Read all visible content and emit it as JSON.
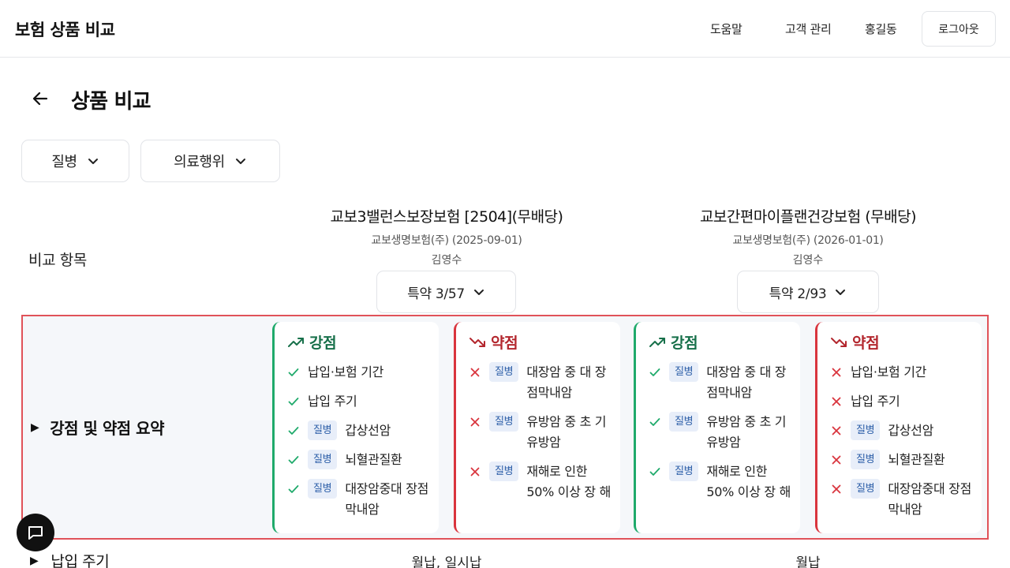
{
  "header": {
    "brand": "보험 상품 비교",
    "nav": [
      "도움말",
      "고객 관리",
      "홍길동"
    ],
    "logout_label": "로그아웃"
  },
  "page": {
    "title": "상품 비교"
  },
  "filters": [
    "질병",
    "의료행위"
  ],
  "compare_label": "비교 항목",
  "products": [
    {
      "name": "교보3밸런스보장보험 [2504](무배당)",
      "company": "교보생명보험(주) (2025-09-01)",
      "agent": "김영수",
      "rider_label": "특약 3/57"
    },
    {
      "name": "교보간편마이플랜건강보험 (무배당)",
      "company": "교보생명보험(주) (2026-01-01)",
      "agent": "김영수",
      "rider_label": "특약 2/93"
    }
  ],
  "summary": {
    "label": "강점 및 약점 요약",
    "strength_title": "강점",
    "weakness_title": "약점",
    "cards": [
      {
        "kind": "pro",
        "items": [
          {
            "tag": "",
            "text": "납입·보험 기간"
          },
          {
            "tag": "",
            "text": "납입 주기"
          },
          {
            "tag": "질병",
            "text": "갑상선암"
          },
          {
            "tag": "질병",
            "text": "뇌혈관질환"
          },
          {
            "tag": "질병",
            "text": "대장암중대 장점막내암"
          }
        ]
      },
      {
        "kind": "con",
        "items": [
          {
            "tag": "질병",
            "text": "대장암 중 대 장점막내암"
          },
          {
            "tag": "질병",
            "text": "유방암 중 초 기유방암"
          },
          {
            "tag": "질병",
            "text": "재해로 인한 50% 이상 장 해"
          }
        ]
      },
      {
        "kind": "pro",
        "items": [
          {
            "tag": "질병",
            "text": "대장암 중 대 장점막내암"
          },
          {
            "tag": "질병",
            "text": "유방암 중 초 기유방암"
          },
          {
            "tag": "질병",
            "text": "재해로 인한 50% 이상 장 해"
          }
        ]
      },
      {
        "kind": "con",
        "items": [
          {
            "tag": "",
            "text": "납입·보험 기간"
          },
          {
            "tag": "",
            "text": "납입 주기"
          },
          {
            "tag": "질병",
            "text": "갑상선암"
          },
          {
            "tag": "질병",
            "text": "뇌혈관질환"
          },
          {
            "tag": "질병",
            "text": "대장암중대 장점막내암"
          }
        ]
      }
    ]
  },
  "payment_row": {
    "label": "납입 주기",
    "values": [
      "월납, 일시납",
      "월납"
    ]
  },
  "icons": {
    "back": "arrow-left-icon",
    "chevron": "chevron-down-icon",
    "strength": "trending-up-icon",
    "weakness": "trending-down-icon",
    "check": "check-icon",
    "cross": "x-icon",
    "chat": "chat-bubble-icon",
    "expand": "triangle-right-icon"
  },
  "colors": {
    "strength": "#1faa6b",
    "weakness": "#d9343d",
    "highlight_border": "#e05259",
    "tag_bg": "#e8eef9",
    "tag_text": "#2c5ea8"
  }
}
